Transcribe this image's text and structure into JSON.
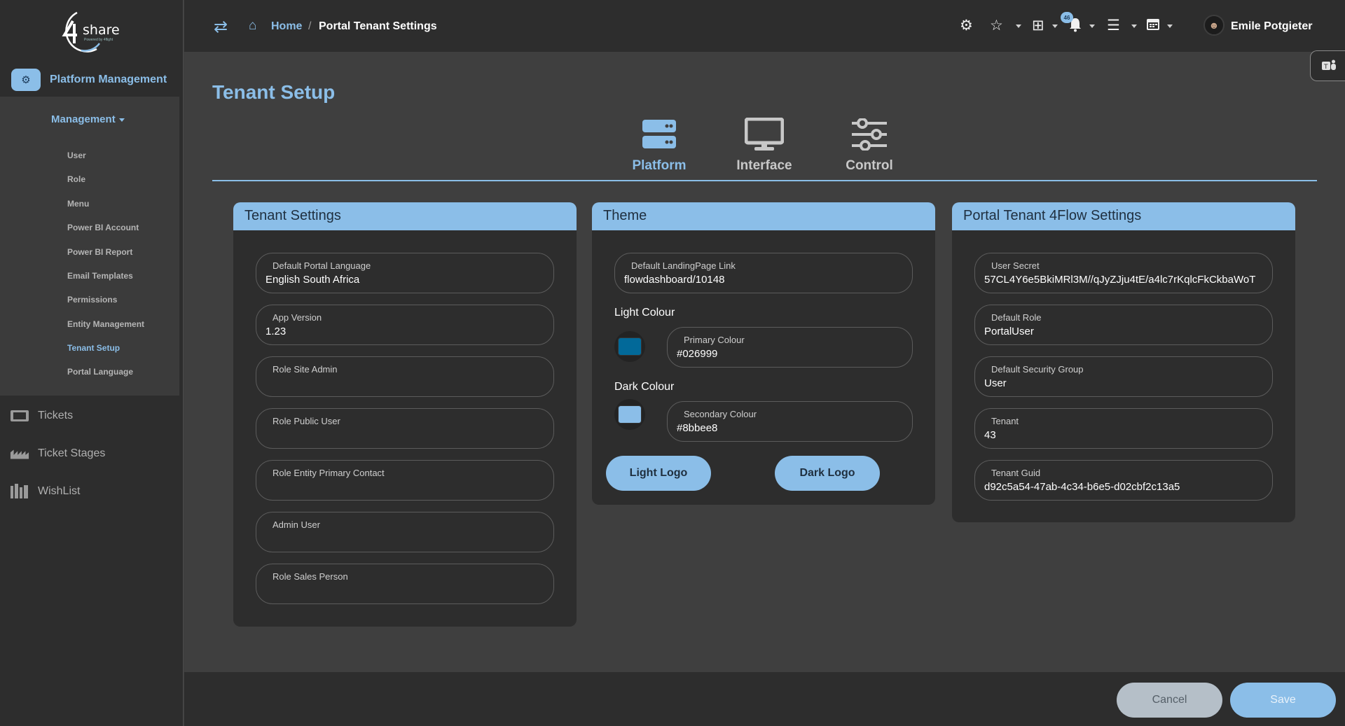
{
  "brand": {
    "logo_text": "share",
    "logo_mark": "4",
    "tagline": "Powered by 4flight"
  },
  "sidebar": {
    "section_title": "Platform Management",
    "management_label": "Management",
    "management_items": [
      {
        "label": "User"
      },
      {
        "label": "Role"
      },
      {
        "label": "Menu"
      },
      {
        "label": "Power BI Account"
      },
      {
        "label": "Power BI Report"
      },
      {
        "label": "Email Templates"
      },
      {
        "label": "Permissions"
      },
      {
        "label": "Entity Management"
      },
      {
        "label": "Tenant Setup",
        "active": true
      },
      {
        "label": "Portal Language"
      }
    ],
    "links": [
      {
        "label": "Tickets",
        "icon": "tickets-icon"
      },
      {
        "label": "Ticket Stages",
        "icon": "ticket-stages-icon"
      },
      {
        "label": "WishList",
        "icon": "wishlist-icon"
      }
    ]
  },
  "topbar": {
    "breadcrumb_home": "Home",
    "breadcrumb_separator": "/",
    "breadcrumb_current": "Portal Tenant Settings",
    "notification_count": "46",
    "user_name": "Emile Potgieter"
  },
  "page": {
    "title": "Tenant Setup",
    "tabs": [
      {
        "label": "Platform",
        "icon": "server-icon",
        "active": true
      },
      {
        "label": "Interface",
        "icon": "monitor-icon",
        "active": false
      },
      {
        "label": "Control",
        "icon": "sliders-icon",
        "active": false
      }
    ]
  },
  "tenant_settings": {
    "title": "Tenant Settings",
    "fields": [
      {
        "label": "Default Portal Language",
        "value": "English South Africa"
      },
      {
        "label": "App Version",
        "value": "1.23"
      },
      {
        "label": "Role Site Admin",
        "value": ""
      },
      {
        "label": "Role Public User",
        "value": ""
      },
      {
        "label": "Role Entity Primary Contact",
        "value": ""
      },
      {
        "label": "Admin User",
        "value": ""
      },
      {
        "label": "Role Sales Person",
        "value": ""
      }
    ]
  },
  "theme": {
    "title": "Theme",
    "landing_label": "Default LandingPage Link",
    "landing_value": "flowdashboard/10148",
    "light_label": "Light Colour",
    "primary_label": "Primary Colour",
    "primary_value": "#026999",
    "dark_label": "Dark Colour",
    "secondary_label": "Secondary Colour",
    "secondary_value": "#8bbee8",
    "light_logo_label": "Light Logo",
    "dark_logo_label": "Dark Logo"
  },
  "flow_settings": {
    "title": "Portal Tenant 4Flow Settings",
    "fields": [
      {
        "label": "User Secret",
        "value": "57CL4Y6e5BkiMRl3M//qJyZJju4tE/a4lc7rKqlcFkCkbaWoT"
      },
      {
        "label": "Default Role",
        "value": "PortalUser"
      },
      {
        "label": "Default Security Group",
        "value": "User"
      },
      {
        "label": "Tenant",
        "value": "43"
      },
      {
        "label": "Tenant Guid",
        "value": "d92c5a54-47ab-4c34-b6e5-d02cbf2c13a5"
      }
    ]
  },
  "footer": {
    "cancel_label": "Cancel",
    "save_label": "Save"
  },
  "colors": {
    "accent": "#8bbee8",
    "primary_swatch": "#026999",
    "secondary_swatch": "#8bbee8",
    "background": "#3f3f3f",
    "panel": "#2d2d2d"
  }
}
